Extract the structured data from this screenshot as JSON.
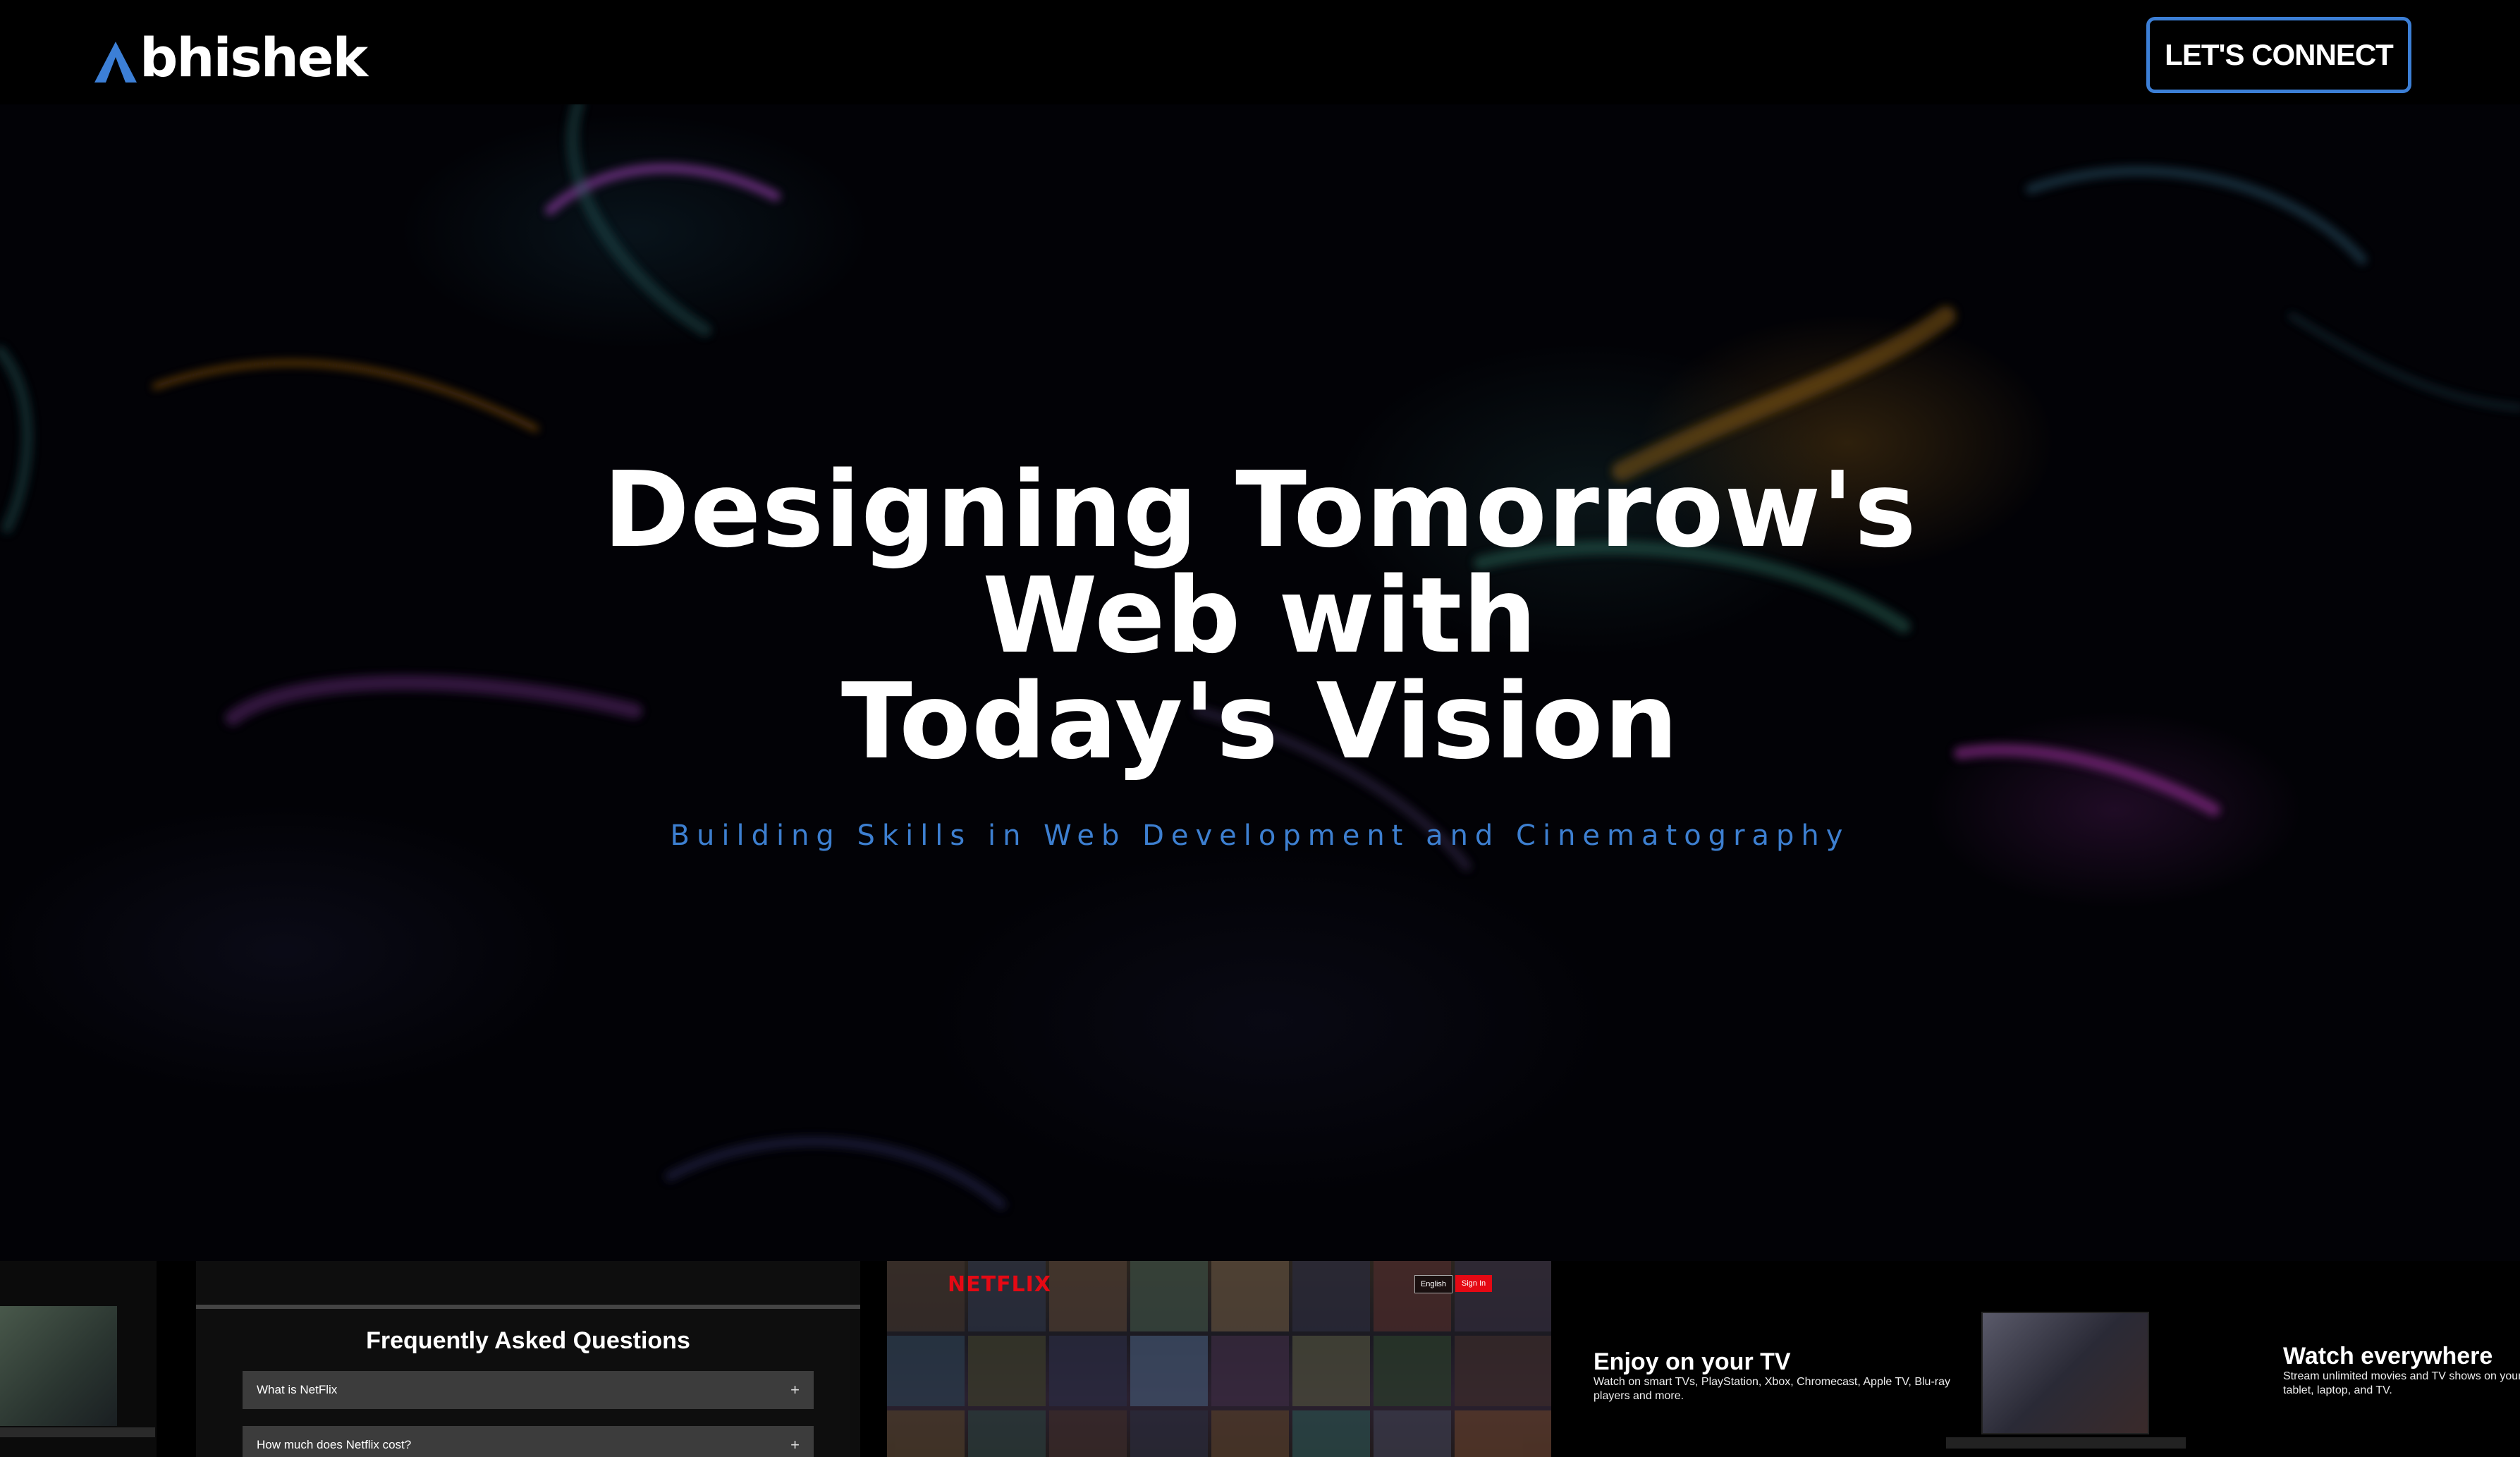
{
  "nav": {
    "logo_text": "bhishek",
    "connect_label": "LET'S CONNECT"
  },
  "hero": {
    "title_lines": [
      "Designing Tomorrow's",
      "Web with",
      "Today's Vision"
    ],
    "subtitle": "Building Skills in Web Development and Cinematography"
  },
  "projects": {
    "faq": {
      "title": "Frequently Asked Questions",
      "items": [
        "What is NetFlix",
        "How much does Netflix cost?"
      ]
    },
    "netflix": {
      "brand": "NETFLIX",
      "lang_label": "English",
      "signin_label": "Sign In"
    },
    "tv": {
      "heading": "Enjoy on your TV",
      "text": "Watch on smart TVs, PlayStation, Xbox, Chromecast, Apple TV, Blu-ray players and more."
    },
    "everywhere": {
      "heading": "Watch everywhere",
      "text": "Stream unlimited movies and TV shows on your phone, tablet, laptop, and TV."
    }
  },
  "colors": {
    "accent": "#3c7fd6",
    "netflix_red": "#e50914"
  }
}
